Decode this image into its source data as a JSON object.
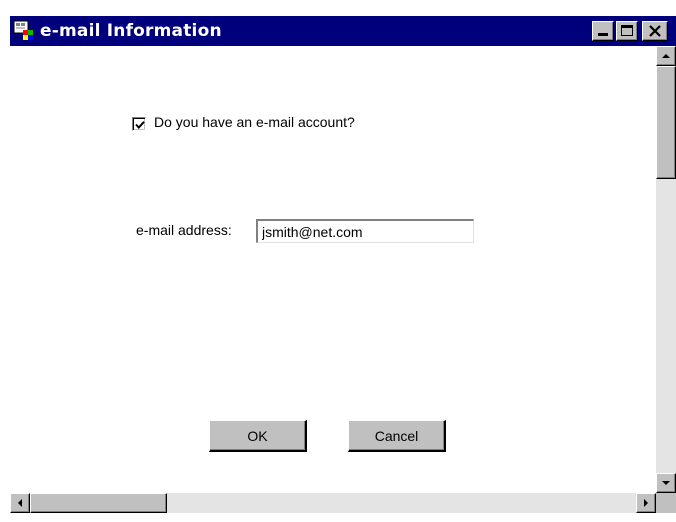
{
  "window": {
    "title": "e-mail Information",
    "app_icon": "app-icon",
    "controls": {
      "minimize_icon": "minimize-icon",
      "maximize_icon": "maximize-icon",
      "close_icon": "close-icon"
    }
  },
  "form": {
    "has_account_label": "Do you have an e-mail account?",
    "has_account_checked": true,
    "email_label": "e-mail address:",
    "email_value": "jsmith@net.com"
  },
  "buttons": {
    "ok_label": "OK",
    "cancel_label": "Cancel"
  },
  "colors": {
    "titlebar": "#00007c",
    "face": "#c0c0c0"
  }
}
